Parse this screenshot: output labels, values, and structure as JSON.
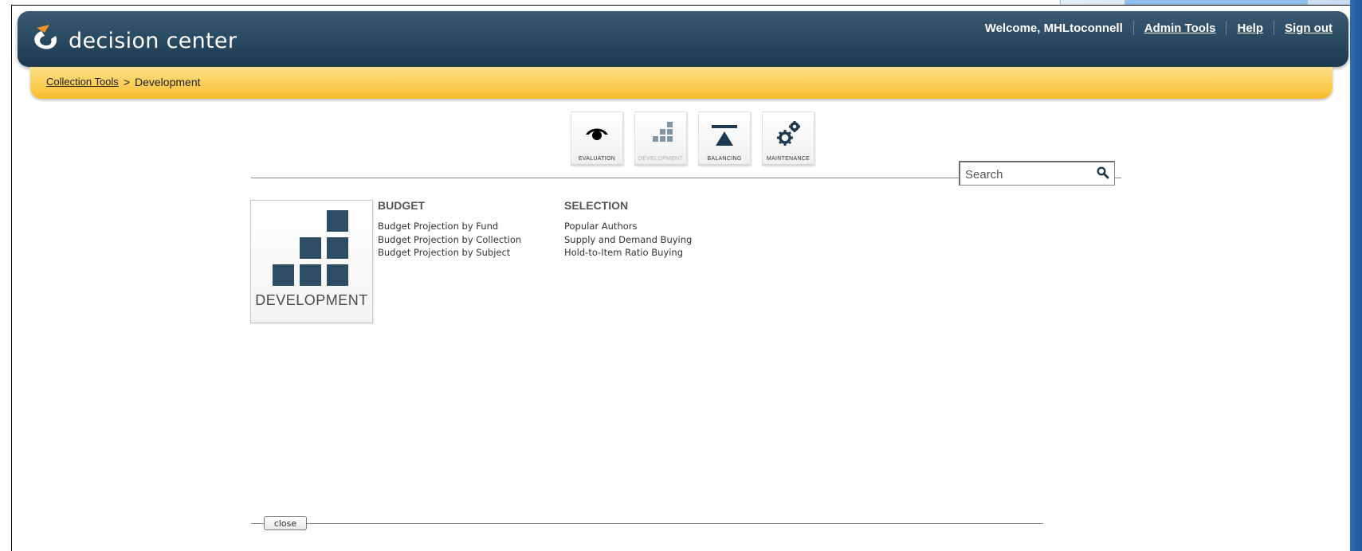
{
  "app": {
    "logo_text": "decision center"
  },
  "user_nav": {
    "welcome": "Welcome, MHLtoconnell",
    "admin_tools": "Admin Tools",
    "help": "Help",
    "sign_out": "Sign out"
  },
  "breadcrumb": {
    "root": "Collection Tools",
    "separator": ">",
    "current": "Development"
  },
  "nav_tiles": [
    {
      "label": "EVALUATION",
      "icon": "eye-icon",
      "active": false
    },
    {
      "label": "DEVELOPMENT",
      "icon": "bar-steps-icon",
      "active": true
    },
    {
      "label": "BALANCING",
      "icon": "balance-icon",
      "active": false
    },
    {
      "label": "MAINTENANCE",
      "icon": "gears-icon",
      "active": false
    }
  ],
  "search": {
    "placeholder": "Search"
  },
  "section": {
    "title": "DEVELOPMENT"
  },
  "budget": {
    "heading": "BUDGET",
    "items": [
      "Budget Projection by Fund",
      "Budget Projection by Collection",
      "Budget Projection by Subject"
    ]
  },
  "selection": {
    "heading": "SELECTION",
    "items": [
      "Popular Authors",
      "Supply and Demand Buying",
      "Hold-to-Item Ratio Buying"
    ]
  },
  "footer": {
    "close_label": "close"
  },
  "colors": {
    "header_dark": "#1d3a50",
    "header_light": "#3b5a71",
    "breadcrumb_gold": "#fbc94a",
    "tile_blue": "#2d4d64",
    "logo_orange": "#f39221",
    "window_accent": "#2c6fb3"
  }
}
